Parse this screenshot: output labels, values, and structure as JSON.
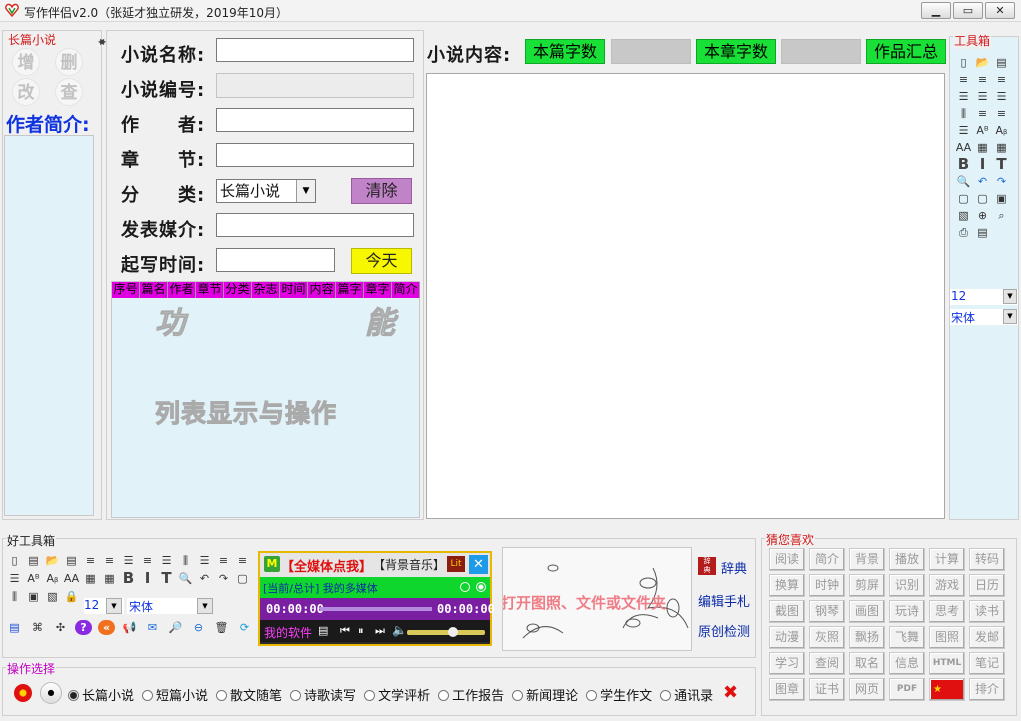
{
  "window": {
    "title": "写作伴侣v2.0（张延才独立研发，2019年10月）",
    "minimize": "▭",
    "maximize": "▭",
    "close": "✕"
  },
  "left_panel": {
    "label": "长篇小说",
    "buttons": [
      "增",
      "删",
      "改",
      "查"
    ],
    "intro_label": "作者简介:"
  },
  "form": {
    "novel_name_label": "小说名称:",
    "novel_id_label": "小说编号:",
    "author_label": "作　　者:",
    "chapter_label": "章　　节:",
    "category_label": "分　　类:",
    "category_value": "长篇小说",
    "clear_button": "清除",
    "media_label": "发表媒介:",
    "start_time_label": "起写时间:",
    "today_button": "今天"
  },
  "table": {
    "columns": [
      "序号",
      "篇名",
      "作者",
      "章节",
      "分类",
      "杂志",
      "时间",
      "内容",
      "篇字",
      "章字",
      "简介"
    ],
    "watermark_1": "功　　能",
    "watermark_2": "列表显示与操作"
  },
  "content": {
    "label": "小说内容:",
    "total_words_button": "本篇字数",
    "chapter_words_button": "本章字数",
    "summary_button": "作品汇总"
  },
  "right_toolbox": {
    "label": "工具箱",
    "font_size": "12",
    "font_name": "宋体"
  },
  "bottom_toolbox": {
    "label": "好工具箱",
    "font_size": "12",
    "font_name": "宋体"
  },
  "media": {
    "title": "【全媒体点我】",
    "music": "【背景音乐】",
    "lit": "Lit",
    "status_prefix": "[当前/总计]",
    "status_text": "我的多媒体",
    "time_current": "00:00:00",
    "time_total": "00:00:00",
    "software": "我的软件"
  },
  "image_preview": {
    "text": "打开图照、文件或文件夹"
  },
  "side_links": {
    "dictionary": "辞典",
    "edit_notes": "编辑手札",
    "originality": "原创检测"
  },
  "guess": {
    "label": "猜您喜欢",
    "items": [
      "阅读",
      "简介",
      "背景",
      "播放",
      "计算",
      "转码",
      "换算",
      "时钟",
      "剪屏",
      "识别",
      "游戏",
      "日历",
      "截图",
      "钢琴",
      "画图",
      "玩诗",
      "思考",
      "读书",
      "动漫",
      "灰照",
      "飘扬",
      "飞舞",
      "图照",
      "发邮",
      "学习",
      "查阅",
      "取名",
      "信息",
      "HTML",
      "笔记",
      "图章",
      "证书",
      "网页",
      "PDF",
      "",
      "排介"
    ]
  },
  "operation": {
    "label": "操作选择",
    "options": [
      "长篇小说",
      "短篇小说",
      "散文随笔",
      "诗歌读写",
      "文学评析",
      "工作报告",
      "新闻理论",
      "学生作文",
      "通讯录"
    ],
    "selected_index": 0
  },
  "colors": {
    "accent_green": "#19e036",
    "panel_bg": "#e1f3f8",
    "magenta": "#e100e1",
    "yellow": "#f7f700",
    "purple": "#c083c8"
  }
}
